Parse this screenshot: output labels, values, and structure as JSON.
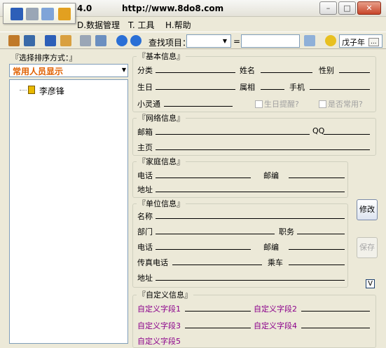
{
  "window": {
    "title_fragment": "4.0",
    "url": "http://www.8do8.com"
  },
  "window_controls": {
    "minimize": "–",
    "maximize": "□",
    "close": "✕"
  },
  "menu": {
    "items": [
      "D.数据管理",
      "T. 工具",
      "H.帮助"
    ]
  },
  "toolbar": {
    "search_label": "查找项目：",
    "equals": "=",
    "year_select": "戊子年",
    "more": "..."
  },
  "left": {
    "title": "『选择排序方式：』",
    "sort_selected": "常用人员显示",
    "tree_items": [
      "李彦锋"
    ]
  },
  "basic": {
    "legend": "『基本信息』",
    "category": "分类",
    "name": "姓名",
    "gender": "性别",
    "birthday": "生日",
    "zodiac": "属相",
    "mobile": "手机",
    "lingtong": "小灵通",
    "birthday_remind": "生日提醒?",
    "is_common": "是否常用?"
  },
  "network": {
    "legend": "『网络信息』",
    "email": "邮箱",
    "qq": "QQ",
    "homepage": "主页"
  },
  "family": {
    "legend": "『家庭信息』",
    "phone": "电话",
    "zip": "邮编",
    "address": "地址"
  },
  "work": {
    "legend": "『单位信息』",
    "name": "名称",
    "department": "部门",
    "position": "职务",
    "phone": "电话",
    "zip": "邮编",
    "fax": "传真电话",
    "bus": "乘车",
    "address": "地址"
  },
  "custom": {
    "legend": "『自定义信息』",
    "fields": [
      "自定义字段1",
      "自定义字段2",
      "自定义字段3",
      "自定义字段4",
      "自定义字段5"
    ]
  },
  "buttons": {
    "modify": "修改",
    "save": "保存",
    "check": "V"
  }
}
